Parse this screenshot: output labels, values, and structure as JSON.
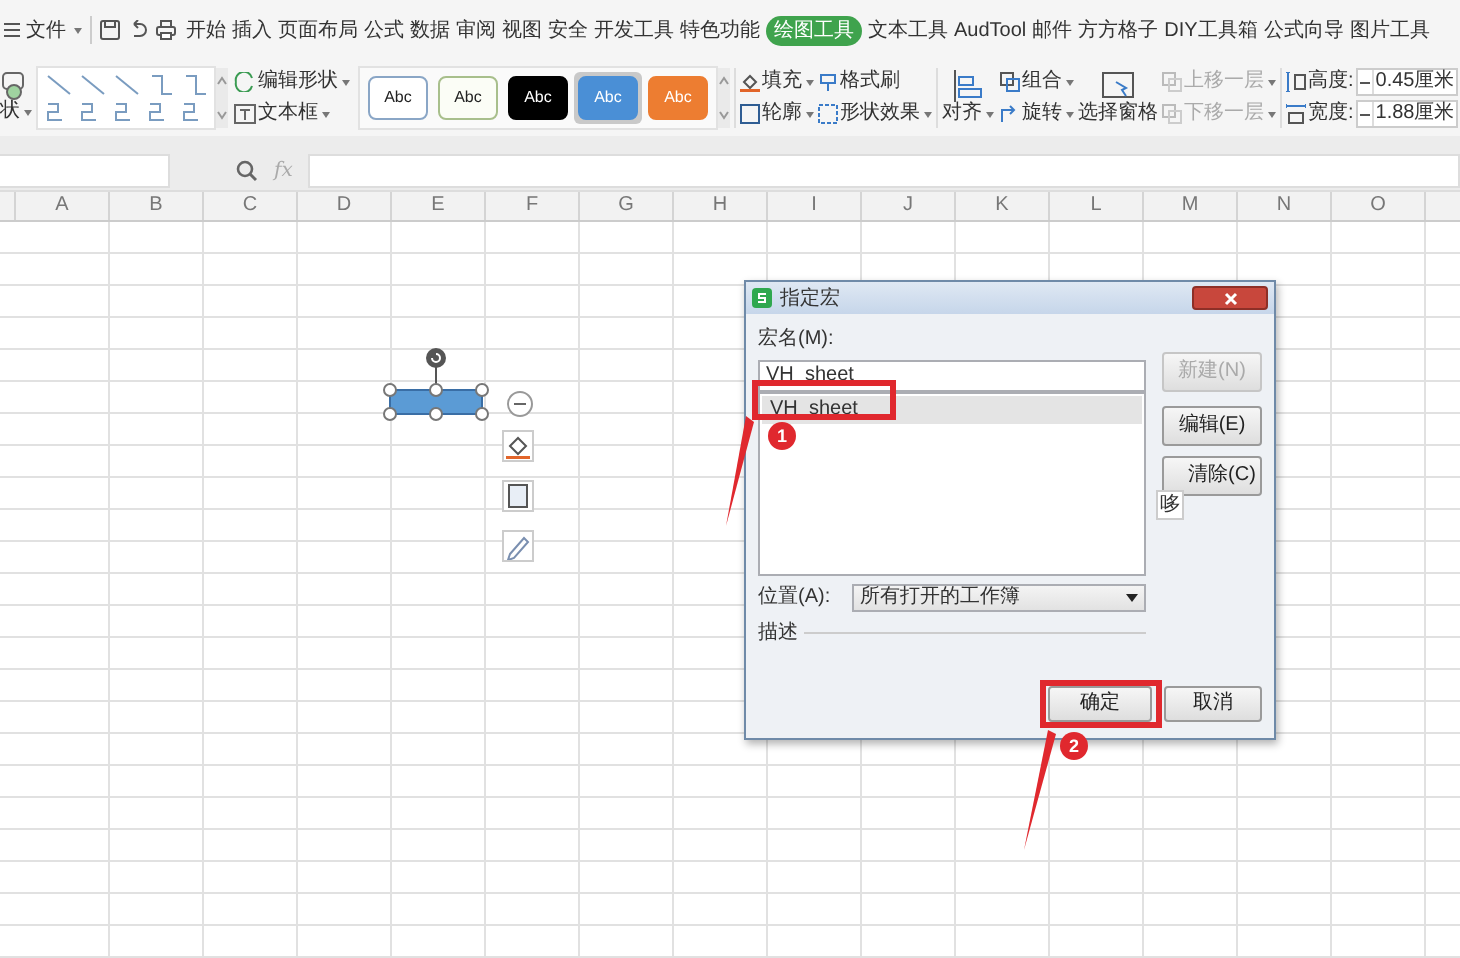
{
  "menu": {
    "file": "文件",
    "tabs": [
      {
        "label": "开始",
        "selected": false
      },
      {
        "label": "插入",
        "selected": false
      },
      {
        "label": "页面布局",
        "selected": false
      },
      {
        "label": "公式",
        "selected": false
      },
      {
        "label": "数据",
        "selected": false
      },
      {
        "label": "审阅",
        "selected": false
      },
      {
        "label": "视图",
        "selected": false
      },
      {
        "label": "安全",
        "selected": false
      },
      {
        "label": "开发工具",
        "selected": false
      },
      {
        "label": "特色功能",
        "selected": false
      },
      {
        "label": "绘图工具",
        "selected": true
      },
      {
        "label": "文本工具",
        "selected": false
      },
      {
        "label": "AudTool",
        "selected": false
      },
      {
        "label": "邮件",
        "selected": false
      },
      {
        "label": "方方格子",
        "selected": false
      },
      {
        "label": "DIY工具箱",
        "selected": false
      },
      {
        "label": "公式向导",
        "selected": false
      },
      {
        "label": "图片工具",
        "selected": false
      }
    ]
  },
  "ribbon": {
    "shape_menu": "状",
    "edit_shape": "编辑形状",
    "text_box": "文本框",
    "styles": [
      {
        "label": "Abc",
        "color": "#ffffff",
        "selected": false
      },
      {
        "label": "Abc",
        "color": "#fbfdf6",
        "selected": false
      },
      {
        "label": "Abc",
        "color": "#000000",
        "selected": false
      },
      {
        "label": "Abc",
        "color": "#4a8fd6",
        "selected": true
      },
      {
        "label": "Abc",
        "color": "#ed7d31",
        "selected": false
      }
    ],
    "fill": "填充",
    "format_painter": "格式刷",
    "outline": "轮廓",
    "shape_effects": "形状效果",
    "align": "对齐",
    "group": "组合",
    "rotate": "旋转",
    "selection_pane": "选择窗格",
    "bring_forward": {
      "label": "上移一层",
      "disabled": true
    },
    "send_backward": {
      "label": "下移一层",
      "disabled": true
    },
    "height": {
      "label": "高度:",
      "value": "0.45厘米"
    },
    "width": {
      "label": "宽度:",
      "value": "1.88厘米"
    }
  },
  "formula_bar": {
    "fx": "fx"
  },
  "columns": [
    "A",
    "B",
    "C",
    "D",
    "E",
    "F",
    "G",
    "H",
    "I",
    "J",
    "K",
    "L",
    "M",
    "N",
    "O"
  ],
  "dialog": {
    "title": "指定宏",
    "name_label": "宏名(M):",
    "name_value": "VH_sheet",
    "macros": [
      {
        "label": "VH_sheet",
        "selected": true
      }
    ],
    "buttons": [
      {
        "label": "新建(N)",
        "disabled": true
      },
      {
        "label": "编辑(E)",
        "disabled": false
      },
      {
        "label": "清除(C)",
        "disabled": false
      }
    ],
    "tooltip": "哆",
    "location_label": "位置(A):",
    "location_value": "所有打开的工作簿",
    "description_label": "描述",
    "ok": "确定",
    "cancel": "取消"
  },
  "callouts": [
    {
      "number": "1"
    },
    {
      "number": "2"
    }
  ]
}
